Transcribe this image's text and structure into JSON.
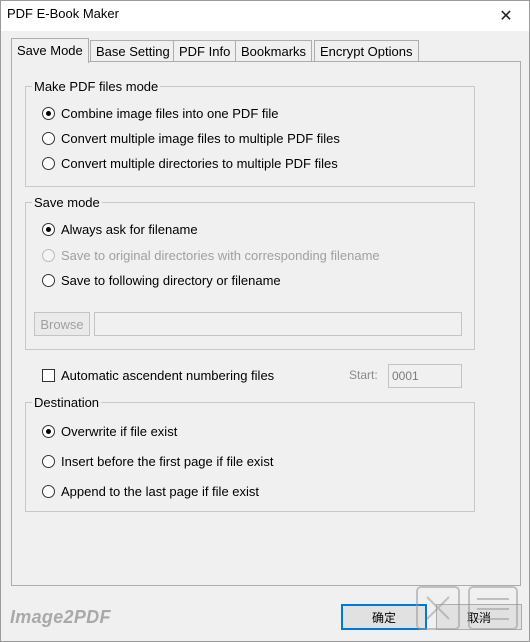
{
  "window": {
    "title": "PDF E-Book Maker",
    "close_glyph": "✕"
  },
  "tabs": [
    {
      "label": "Save Mode",
      "active": true
    },
    {
      "label": "Base Setting",
      "active": false
    },
    {
      "label": "PDF Info",
      "active": false
    },
    {
      "label": "Bookmarks",
      "active": false
    },
    {
      "label": "Encrypt Options",
      "active": false
    }
  ],
  "make_mode": {
    "legend": "Make PDF files mode",
    "options": [
      {
        "label": "Combine image files into one PDF file",
        "selected": true
      },
      {
        "label": "Convert multiple image files to multiple PDF files",
        "selected": false
      },
      {
        "label": "Convert multiple directories to multiple PDF files",
        "selected": false
      }
    ]
  },
  "save_mode": {
    "legend": "Save mode",
    "options": [
      {
        "label": "Always ask for filename",
        "selected": true,
        "enabled": true
      },
      {
        "label": "Save to original directories with corresponding filename",
        "selected": false,
        "enabled": false
      },
      {
        "label": "Save to following directory or filename",
        "selected": false,
        "enabled": true
      }
    ],
    "browse_label": "Browse",
    "path_value": ""
  },
  "numbering": {
    "label": "Automatic ascendent numbering files",
    "checked": false,
    "start_label": "Start:",
    "start_value": "0001"
  },
  "destination": {
    "legend": "Destination",
    "options": [
      {
        "label": "Overwrite if file exist",
        "selected": true
      },
      {
        "label": "Insert before the first page if file exist",
        "selected": false
      },
      {
        "label": "Append to the last page if file exist",
        "selected": false
      }
    ]
  },
  "footer": {
    "brand": "Image2PDF",
    "ok_label": "确定",
    "cancel_label": "取消"
  },
  "colors": {
    "accent": "#0078d7",
    "panel_bg": "#f0f0f0"
  },
  "icons": {
    "close": "close-icon"
  }
}
